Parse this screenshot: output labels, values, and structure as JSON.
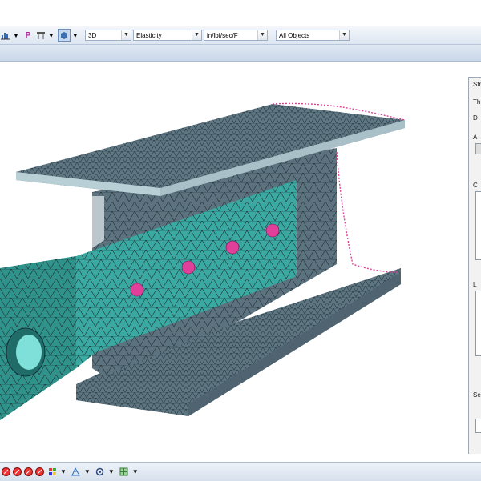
{
  "toolbar": {
    "icons": [
      "chart-icon",
      "dropdown-arrow",
      "p-icon",
      "hierarchy-icon",
      "dropdown-arrow",
      "view-cube-icon",
      "dropdown-arrow"
    ],
    "combos": [
      {
        "name": "view-mode-combo",
        "value": "3D"
      },
      {
        "name": "analysis-type-combo",
        "value": "Elasticity"
      },
      {
        "name": "units-combo",
        "value": "in/lbf/sec/F"
      },
      {
        "name": "selection-filter-combo",
        "value": "All Objects"
      }
    ]
  },
  "panel": {
    "title_fragment": "Str",
    "labels": [
      "Th",
      "D",
      "A",
      "C",
      "L",
      "Se"
    ]
  },
  "model": {
    "mesh_color": "#3aa9a1",
    "beam_color": "#5e7682",
    "highlight_color": "#e0409a"
  },
  "statusbar": {
    "icons": [
      "delete-icon",
      "delete-icon",
      "delete-icon",
      "delete-icon",
      "color-tool-icon",
      "mesh-icon",
      "settings-icon",
      "grid-icon"
    ]
  }
}
